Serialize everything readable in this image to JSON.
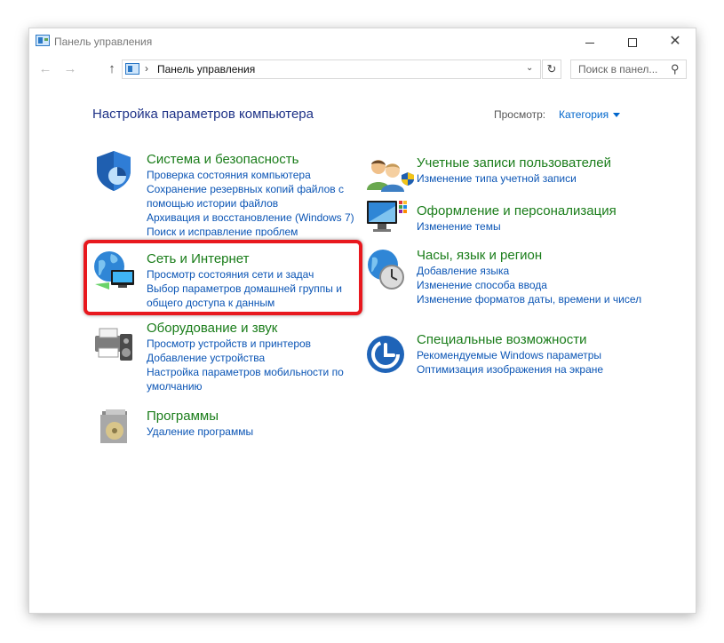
{
  "window": {
    "title": "Панель управления"
  },
  "address_bar": {
    "path": "Панель управления",
    "separator": "›",
    "search_placeholder": "Поиск в панел..."
  },
  "header": {
    "title": "Настройка параметров компьютера",
    "view_by_label": "Просмотр:",
    "view_by_value": "Категория"
  },
  "categories": [
    {
      "title": "Система и безопасность",
      "icon": "shield-icon",
      "links": [
        "Проверка состояния компьютера",
        "Сохранение резервных копий файлов с помощью истории файлов",
        "Архивация и восстановление (Windows 7)",
        "Поиск и исправление проблем"
      ]
    },
    {
      "title": "Сеть и Интернет",
      "icon": "network-globe-icon",
      "links": [
        "Просмотр состояния сети и задач",
        "Выбор параметров домашней группы и общего доступа к данным"
      ]
    },
    {
      "title": "Оборудование и звук",
      "icon": "printer-speaker-icon",
      "links": [
        "Просмотр устройств и принтеров",
        "Добавление устройства",
        "Настройка параметров мобильности по умолчанию"
      ]
    },
    {
      "title": "Программы",
      "icon": "programs-icon",
      "links": [
        "Удаление программы"
      ]
    },
    {
      "title": "Учетные записи пользователей",
      "icon": "users-icon",
      "links": [
        "Изменение типа учетной записи"
      ]
    },
    {
      "title": "Оформление и персонализация",
      "icon": "monitor-palette-icon",
      "links": [
        "Изменение темы"
      ]
    },
    {
      "title": "Часы, язык и регион",
      "icon": "clock-globe-icon",
      "links": [
        "Добавление языка",
        "Изменение способа ввода",
        "Изменение форматов даты, времени и чисел"
      ]
    },
    {
      "title": "Специальные возможности",
      "icon": "ease-of-access-icon",
      "links": [
        "Рекомендуемые Windows параметры",
        "Оптимизация изображения на экране"
      ]
    }
  ],
  "colors": {
    "category_title": "#1a7d1a",
    "link": "#0b55b5",
    "heading": "#1e3287",
    "highlight": "#e8181e"
  }
}
